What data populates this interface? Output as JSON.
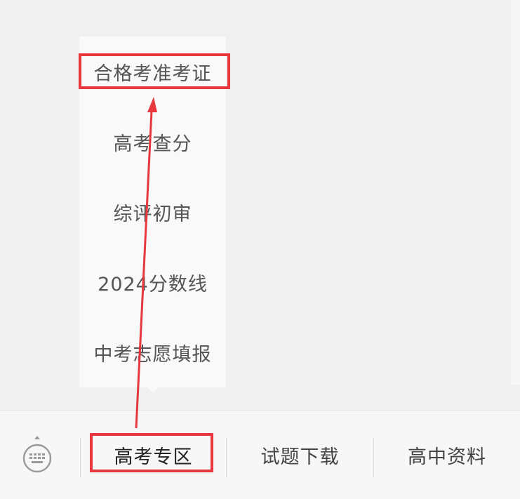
{
  "popup_menu": {
    "items": [
      {
        "label": "合格考准考证"
      },
      {
        "label": "高考查分"
      },
      {
        "label": "综评初审"
      },
      {
        "label": "2024分数线"
      },
      {
        "label": "中考志愿填报"
      }
    ]
  },
  "menubar": {
    "keyboard_icon": "keyboard-icon",
    "tabs": [
      {
        "label": "高考专区",
        "active": true
      },
      {
        "label": "试题下载"
      },
      {
        "label": "高中资料"
      }
    ]
  },
  "annotation": {
    "color": "#e8383f"
  }
}
